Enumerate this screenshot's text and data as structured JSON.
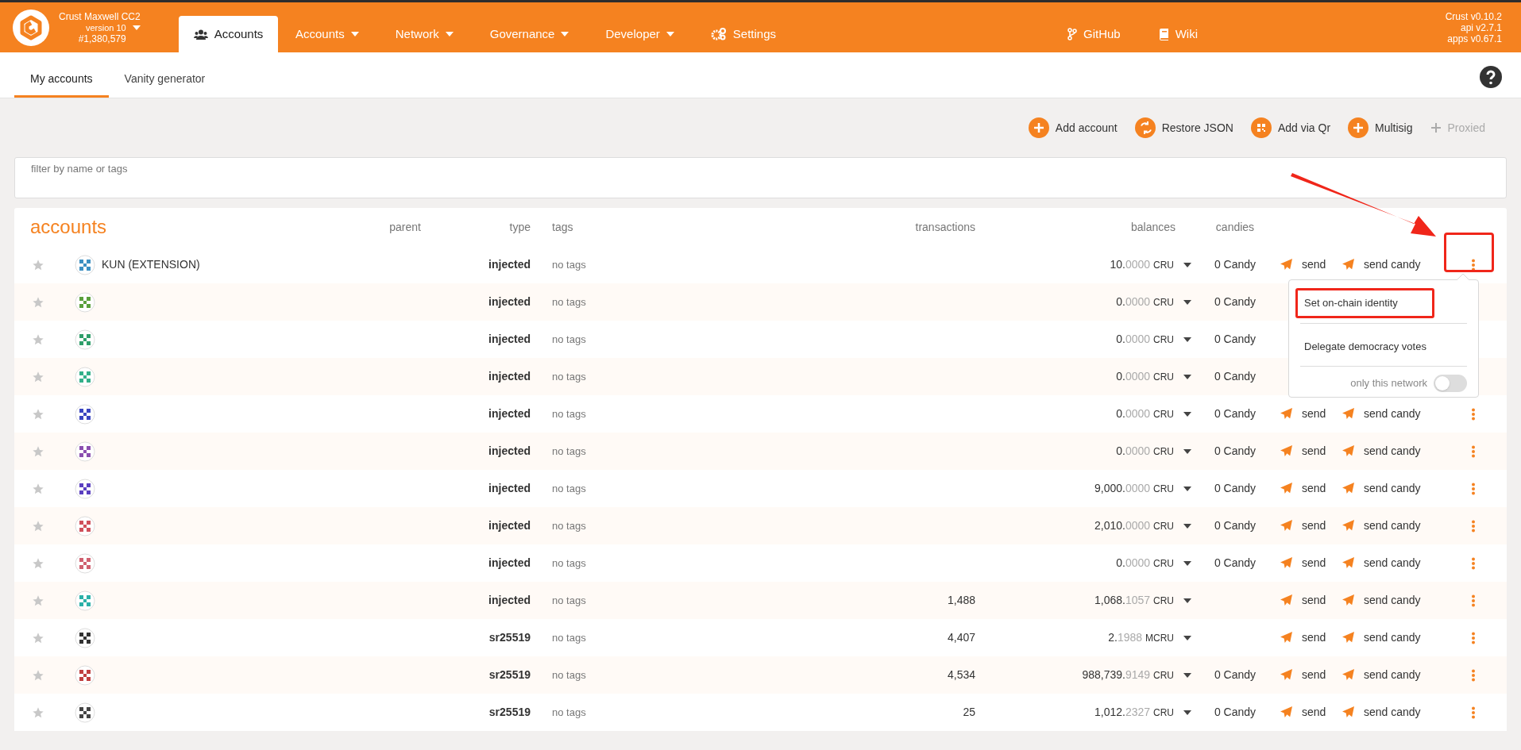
{
  "header": {
    "chain_name": "Crust Maxwell CC2",
    "version": "version 10",
    "block": "#1,380,579",
    "active_tab": "Accounts",
    "nav": [
      {
        "label": "Accounts",
        "kind": "menu"
      },
      {
        "label": "Network",
        "kind": "menu"
      },
      {
        "label": "Governance",
        "kind": "menu"
      },
      {
        "label": "Developer",
        "kind": "menu"
      },
      {
        "label": "Settings",
        "kind": "settings"
      }
    ],
    "links": [
      {
        "label": "GitHub",
        "kind": "github"
      },
      {
        "label": "Wiki",
        "kind": "wiki"
      }
    ],
    "versions": [
      "Crust v0.10.2",
      "api v2.7.1",
      "apps v0.67.1"
    ]
  },
  "subtabs": [
    {
      "label": "My accounts",
      "selected": true
    },
    {
      "label": "Vanity generator",
      "selected": false
    }
  ],
  "toolbar": [
    {
      "label": "Add account",
      "kind": "add",
      "disabled": false
    },
    {
      "label": "Restore JSON",
      "kind": "restore",
      "disabled": false
    },
    {
      "label": "Add via Qr",
      "kind": "qr",
      "disabled": false
    },
    {
      "label": "Multisig",
      "kind": "add",
      "disabled": false
    },
    {
      "label": "Proxied",
      "kind": "add",
      "disabled": true
    }
  ],
  "filter": {
    "placeholder": "filter by name or tags"
  },
  "table": {
    "title": "accounts",
    "columns": [
      "parent",
      "type",
      "tags",
      "transactions",
      "balances",
      "candies"
    ],
    "rows": [
      {
        "name": "KUN (EXTENSION)",
        "color": "#3b8fc2",
        "type": "injected",
        "tags": "no tags",
        "balance": {
          "whole": "10.",
          "decimals": "0000",
          "unit": "CRU"
        },
        "candy": "0 Candy",
        "send": "send",
        "send_candy": "send candy"
      },
      {
        "color": "#5aa03c",
        "type": "injected",
        "tags": "no tags",
        "balance": {
          "whole": "0.",
          "decimals": "0000",
          "unit": "CRU"
        },
        "candy": "0 Candy"
      },
      {
        "color": "#2f9e6a",
        "type": "injected",
        "tags": "no tags",
        "balance": {
          "whole": "0.",
          "decimals": "0000",
          "unit": "CRU"
        },
        "candy": "0 Candy"
      },
      {
        "color": "#33b08a",
        "type": "injected",
        "tags": "no tags",
        "balance": {
          "whole": "0.",
          "decimals": "0000",
          "unit": "CRU"
        },
        "candy": "0 Candy"
      },
      {
        "color": "#3a45c0",
        "type": "injected",
        "tags": "no tags",
        "balance": {
          "whole": "0.",
          "decimals": "0000",
          "unit": "CRU"
        },
        "candy": "0 Candy",
        "send": "send",
        "send_candy": "send candy"
      },
      {
        "color": "#8a4fb0",
        "type": "injected",
        "tags": "no tags",
        "balance": {
          "whole": "0.",
          "decimals": "0000",
          "unit": "CRU"
        },
        "candy": "0 Candy",
        "send": "send",
        "send_candy": "send candy"
      },
      {
        "color": "#5a3fc0",
        "type": "injected",
        "tags": "no tags",
        "balance": {
          "whole": "9,000.",
          "decimals": "0000",
          "unit": "CRU"
        },
        "candy": "0 Candy",
        "send": "send",
        "send_candy": "send candy"
      },
      {
        "color": "#d0505a",
        "type": "injected",
        "tags": "no tags",
        "balance": {
          "whole": "2,010.",
          "decimals": "0000",
          "unit": "CRU"
        },
        "candy": "0 Candy",
        "send": "send",
        "send_candy": "send candy"
      },
      {
        "color": "#d06070",
        "type": "injected",
        "tags": "no tags",
        "balance": {
          "whole": "0.",
          "decimals": "0000",
          "unit": "CRU"
        },
        "candy": "0 Candy",
        "send": "send",
        "send_candy": "send candy"
      },
      {
        "color": "#2ab0a8",
        "type": "injected",
        "tags": "no tags",
        "transactions": "1,488",
        "balance": {
          "whole": "1,068.",
          "decimals": "1057",
          "unit": "CRU"
        },
        "send": "send",
        "send_candy": "send candy"
      },
      {
        "color": "#333333",
        "type": "sr25519",
        "tags": "no tags",
        "transactions": "4,407",
        "balance": {
          "whole": "2.",
          "decimals": "1988",
          "unit": "MCRU"
        },
        "send": "send",
        "send_candy": "send candy"
      },
      {
        "color": "#c04040",
        "type": "sr25519",
        "tags": "no tags",
        "transactions": "4,534",
        "balance": {
          "whole": "988,739.",
          "decimals": "9149",
          "unit": "CRU"
        },
        "candy": "0 Candy",
        "send": "send",
        "send_candy": "send candy"
      },
      {
        "color": "#444444",
        "type": "sr25519",
        "tags": "no tags",
        "transactions": "25",
        "balance": {
          "whole": "1,012.",
          "decimals": "2327",
          "unit": "CRU"
        },
        "candy": "0 Candy",
        "send": "send",
        "send_candy": "send candy"
      }
    ]
  },
  "menu": {
    "items": [
      {
        "label": "Set on-chain identity",
        "highlighted": true
      },
      {
        "label": "Delegate democracy votes",
        "highlighted": false
      }
    ],
    "toggle": {
      "label": "only this network",
      "on": false
    }
  }
}
